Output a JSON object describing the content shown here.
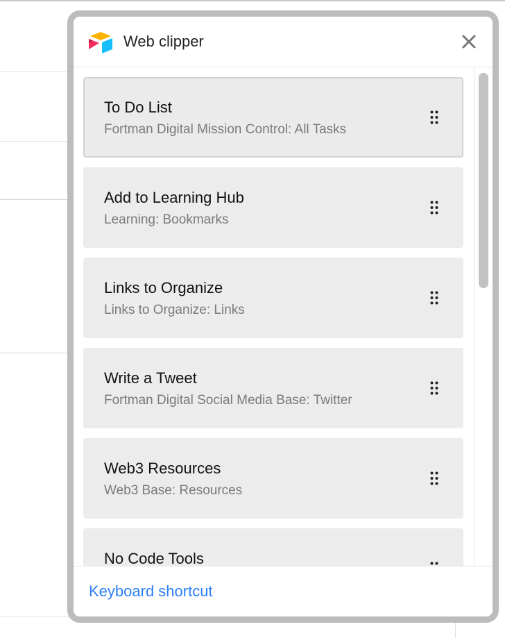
{
  "popup": {
    "title": "Web clipper",
    "logo_icon": "airtable-logo-icon",
    "close_icon": "close-icon"
  },
  "clips": [
    {
      "title": "To Do List",
      "subtitle": "Fortman Digital Mission Control: All Tasks",
      "selected": true
    },
    {
      "title": "Add to Learning Hub",
      "subtitle": "Learning: Bookmarks",
      "selected": false
    },
    {
      "title": "Links to Organize",
      "subtitle": "Links to Organize: Links",
      "selected": false
    },
    {
      "title": "Write a Tweet",
      "subtitle": "Fortman Digital Social Media Base: Twitter",
      "selected": false
    },
    {
      "title": "Web3 Resources",
      "subtitle": "Web3 Base: Resources",
      "selected": false
    },
    {
      "title": "No Code Tools",
      "subtitle": "",
      "selected": false
    }
  ],
  "footer": {
    "link_label": "Keyboard shortcut"
  },
  "colors": {
    "link": "#2d7ff9",
    "card_bg": "#ececec",
    "logo_yellow": "#fcb400",
    "logo_blue": "#18bfff",
    "logo_red": "#f82b60"
  }
}
